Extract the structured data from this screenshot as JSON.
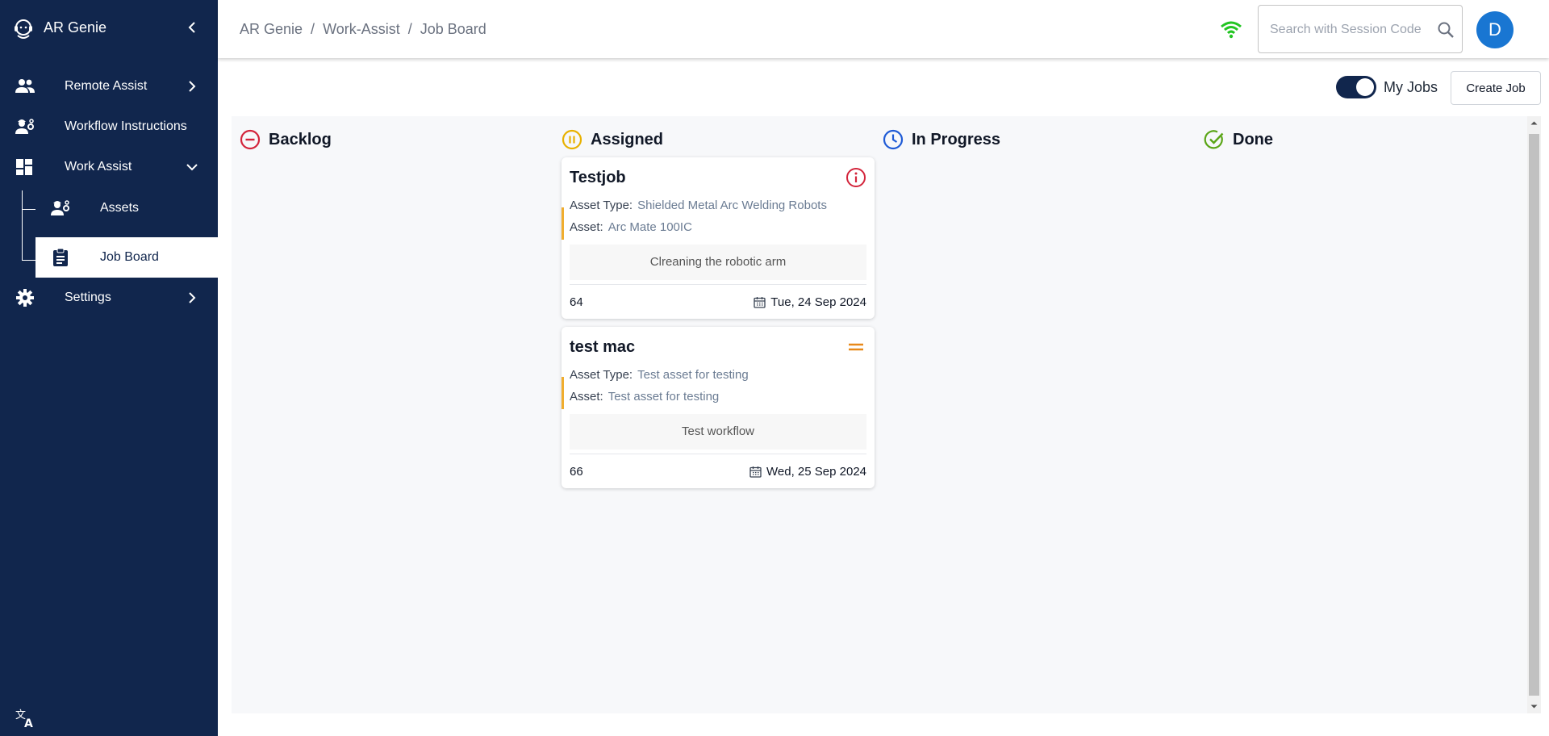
{
  "sidebar": {
    "brand": "AR Genie",
    "items": [
      {
        "label": "Remote Assist",
        "icon": "people-icon"
      },
      {
        "label": "Workflow Instructions",
        "icon": "engineer-icon"
      },
      {
        "label": "Work Assist",
        "icon": "dashboard-icon"
      },
      {
        "label": "Settings",
        "icon": "gear-icon"
      }
    ],
    "subitems": [
      {
        "label": "Assets",
        "icon": "engineer-icon"
      },
      {
        "label": "Job Board",
        "icon": "clipboard-icon"
      }
    ],
    "active": "Job Board"
  },
  "header": {
    "breadcrumb": [
      "AR Genie",
      "Work-Assist",
      "Job Board"
    ],
    "separator": "/",
    "search_placeholder": "Search with Session Code",
    "avatar_initial": "D"
  },
  "toolbar": {
    "my_jobs_label": "My Jobs",
    "my_jobs_on": true,
    "create_job_label": "Create Job"
  },
  "board": {
    "columns": [
      {
        "title": "Backlog",
        "icon": "minus-circle-icon",
        "color": "#d3243b"
      },
      {
        "title": "Assigned",
        "icon": "pause-circle-icon",
        "color": "#e8b100"
      },
      {
        "title": "In Progress",
        "icon": "clock-icon",
        "color": "#1f5bd6"
      },
      {
        "title": "Done",
        "icon": "check-circle-icon",
        "color": "#5aa516"
      }
    ],
    "cards": [
      {
        "title": "Testjob",
        "priority_icon": "info-circle-icon",
        "priority_color": "#d3243b",
        "asset_type_label": "Asset Type:",
        "asset_type": "Shielded Metal Arc Welding Robots",
        "asset_label": "Asset:",
        "asset": "Arc Mate 100IC",
        "workflow": "Clreaning the robotic arm",
        "id": "64",
        "date": "Tue, 24 Sep 2024"
      },
      {
        "title": "test mac",
        "priority_icon": "equals-icon",
        "priority_color": "#e8891a",
        "asset_type_label": "Asset Type:",
        "asset_type": "Test asset for testing",
        "asset_label": "Asset:",
        "asset": "Test asset for testing",
        "workflow": "Test workflow",
        "id": "66",
        "date": "Wed, 25 Sep 2024"
      }
    ]
  },
  "colors": {
    "sidebar_bg": "#11264d",
    "accent": "#f0ad2e",
    "wifi": "#22c522",
    "avatar": "#1976d2"
  }
}
